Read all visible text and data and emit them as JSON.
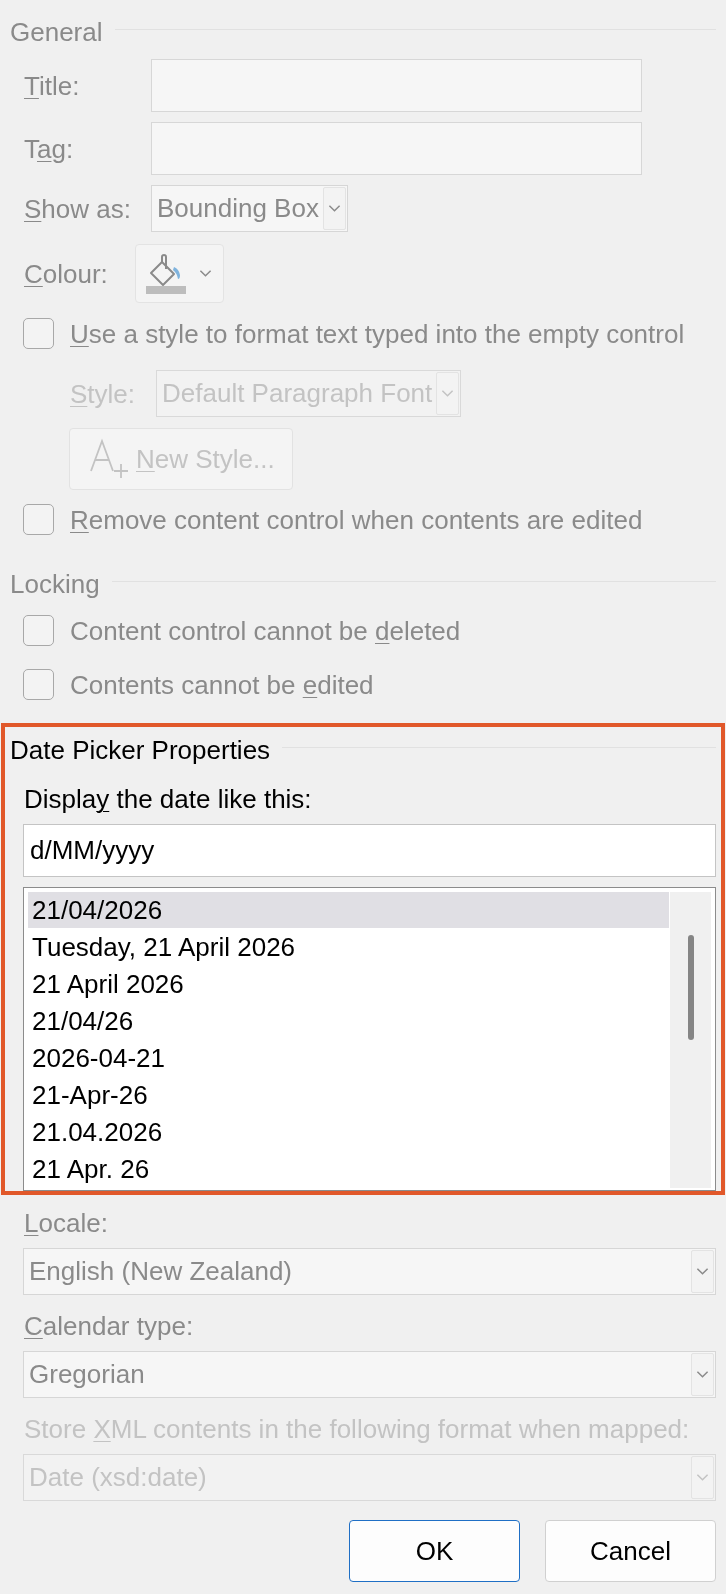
{
  "general": {
    "heading": "General",
    "dimmed": true,
    "fields": [
      {
        "kind": "text",
        "label": {
          "key": "T",
          "after": "itle:"
        }
      },
      {
        "kind": "text",
        "label": {
          "before": "T",
          "key": "a",
          "after": "g:"
        }
      },
      {
        "kind": "select",
        "label": {
          "key": "S",
          "after": "how as:"
        },
        "value": "Bounding Box"
      },
      {
        "kind": "color",
        "label": {
          "key": "C",
          "after": "olour:"
        }
      }
    ],
    "use_style": {
      "label": {
        "key": "U",
        "after": "se a style to format text typed into the empty control"
      },
      "checked": false
    },
    "style": {
      "label": {
        "key": "S",
        "after": "tyle:"
      },
      "value": "Default Paragraph Font",
      "disabled": true
    },
    "new_style": {
      "label": {
        "key": "N",
        "after": "ew Style..."
      },
      "disabled": true
    },
    "remove_when_edited": {
      "label": {
        "key": "R",
        "after": "emove content control when contents are edited"
      },
      "checked": false
    }
  },
  "locking": {
    "heading": "Locking",
    "dimmed": true,
    "options": [
      {
        "label": {
          "before": "Content control cannot be ",
          "key": "d",
          "after": "eleted"
        },
        "checked": false
      },
      {
        "label": {
          "before": "Contents cannot be ",
          "key": "e",
          "after": "dited"
        },
        "checked": false
      }
    ]
  },
  "date_picker": {
    "heading": "Date Picker Properties",
    "highlighted": true,
    "format_label": {
      "before": "Displa",
      "key": "y",
      "after": " the date like this:"
    },
    "format_value": "d/MM/yyyy",
    "formats": [
      {
        "text": "21/04/2026",
        "selected": true
      },
      {
        "text": "Tuesday, 21 April 2026",
        "selected": false
      },
      {
        "text": "21 April 2026",
        "selected": false
      },
      {
        "text": "21/04/26",
        "selected": false
      },
      {
        "text": "2026-04-21",
        "selected": false
      },
      {
        "text": "21-Apr-26",
        "selected": false
      },
      {
        "text": "21.04.2026",
        "selected": false
      },
      {
        "text": "21 Apr. 26",
        "selected": false
      }
    ]
  },
  "locale": {
    "label": {
      "key": "L",
      "after": "ocale:"
    },
    "value": "English (New Zealand)",
    "dimmed": true
  },
  "calendar_type": {
    "label": {
      "key": "C",
      "after": "alendar type:"
    },
    "value": "Gregorian",
    "dimmed": true
  },
  "xml_format": {
    "label": {
      "before": "Store ",
      "key": "X",
      "after": "ML contents in the following format when mapped:"
    },
    "value": "Date (xsd:date)",
    "disabled": true
  },
  "buttons": [
    {
      "label": "OK",
      "default": true
    },
    {
      "label": "Cancel",
      "default": false
    }
  ]
}
